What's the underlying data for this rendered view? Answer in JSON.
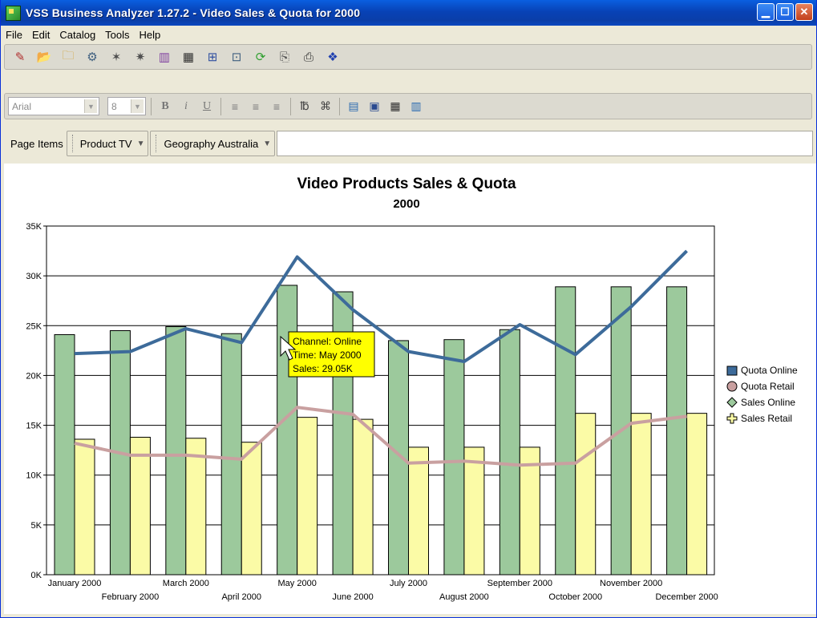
{
  "window": {
    "title": "VSS Business Analyzer 1.27.2 - Video Sales & Quota for 2000"
  },
  "menu": [
    "File",
    "Edit",
    "Catalog",
    "Tools",
    "Help"
  ],
  "format_toolbar": {
    "font": "Arial",
    "size": "8"
  },
  "page_items": {
    "label": "Page Items",
    "product": "Product  TV",
    "geography": "Geography  Australia"
  },
  "tooltip": {
    "line1": "Channel: Online",
    "line2": "Time: May 2000",
    "line3": "Sales: 29.05K"
  },
  "colors": {
    "quota_online": "#3d6b9a",
    "quota_retail": "#c9a0a0",
    "sales_online": "#9cc99c",
    "sales_retail": "#fbfba6",
    "tooltip_bg": "#ffff00"
  },
  "chart_data": {
    "type": "bar",
    "title": "Video Products Sales & Quota",
    "subtitle": "2000",
    "categories": [
      "January 2000",
      "February 2000",
      "March 2000",
      "April 2000",
      "May 2000",
      "June 2000",
      "July 2000",
      "August 2000",
      "September 2000",
      "October 2000",
      "November 2000",
      "December 2000"
    ],
    "ylim": [
      0,
      35000
    ],
    "yticks": [
      0,
      5000,
      10000,
      15000,
      20000,
      25000,
      30000,
      35000
    ],
    "ytick_labels": [
      "0K",
      "5K",
      "10K",
      "15K",
      "20K",
      "25K",
      "30K",
      "35K"
    ],
    "grid": true,
    "legend_position": "right",
    "series": [
      {
        "name": "Sales Online",
        "kind": "bar",
        "values": [
          24100,
          24500,
          24900,
          24200,
          29050,
          28400,
          23500,
          23600,
          24600,
          28900,
          28900,
          28900
        ]
      },
      {
        "name": "Sales Retail",
        "kind": "bar",
        "values": [
          13600,
          13800,
          13700,
          13300,
          15800,
          15600,
          12800,
          12800,
          12800,
          16200,
          16200,
          16200
        ]
      },
      {
        "name": "Quota Online",
        "kind": "line",
        "values": [
          22200,
          22400,
          24700,
          23300,
          31900,
          26600,
          22400,
          21400,
          25100,
          22100,
          26900,
          32500
        ]
      },
      {
        "name": "Quota Retail",
        "kind": "line",
        "values": [
          13200,
          12000,
          12000,
          11600,
          16800,
          16100,
          11200,
          11400,
          11000,
          11200,
          15200,
          15900
        ]
      }
    ],
    "legend": [
      "Quota Online",
      "Quota Retail",
      "Sales Online",
      "Sales Retail"
    ]
  }
}
